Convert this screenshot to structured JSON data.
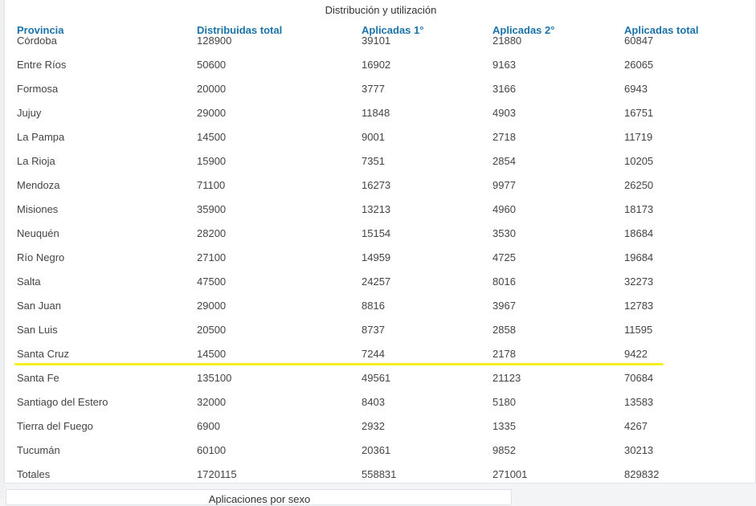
{
  "panel": {
    "title": "Distribución y utilización",
    "columns": [
      "Provincia",
      "Distribuidas total",
      "Aplicadas 1°",
      "Aplicadas 2°",
      "Aplicadas total"
    ],
    "rows": [
      [
        "Córdoba",
        "128900",
        "39101",
        "21880",
        "60847"
      ],
      [
        "Entre Ríos",
        "50600",
        "16902",
        "9163",
        "26065"
      ],
      [
        "Formosa",
        "20000",
        "3777",
        "3166",
        "6943"
      ],
      [
        "Jujuy",
        "29000",
        "11848",
        "4903",
        "16751"
      ],
      [
        "La Pampa",
        "14500",
        "9001",
        "2718",
        "11719"
      ],
      [
        "La Rioja",
        "15900",
        "7351",
        "2854",
        "10205"
      ],
      [
        "Mendoza",
        "71100",
        "16273",
        "9977",
        "26250"
      ],
      [
        "Misiones",
        "35900",
        "13213",
        "4960",
        "18173"
      ],
      [
        "Neuquén",
        "28200",
        "15154",
        "3530",
        "18684"
      ],
      [
        "Río Negro",
        "27100",
        "14959",
        "4725",
        "19684"
      ],
      [
        "Salta",
        "47500",
        "24257",
        "8016",
        "32273"
      ],
      [
        "San Juan",
        "29000",
        "8816",
        "3967",
        "12783"
      ],
      [
        "San Luis",
        "20500",
        "8737",
        "2858",
        "11595"
      ],
      [
        "Santa Cruz",
        "14500",
        "7244",
        "2178",
        "9422"
      ],
      [
        "Santa Fe",
        "135100",
        "49561",
        "21123",
        "70684"
      ],
      [
        "Santiago del Estero",
        "32000",
        "8403",
        "5180",
        "13583"
      ],
      [
        "Tierra del Fuego",
        "6900",
        "2932",
        "1335",
        "4267"
      ],
      [
        "Tucumán",
        "60100",
        "20361",
        "9852",
        "30213"
      ],
      [
        "Totales",
        "1720115",
        "558831",
        "271001",
        "829832"
      ]
    ],
    "highlighted_row": "Santa Cruz",
    "highlight_color": "#f6ef1e",
    "header_color": "#1a73a8"
  },
  "next_panel": {
    "title": "Aplicaciones por sexo"
  }
}
